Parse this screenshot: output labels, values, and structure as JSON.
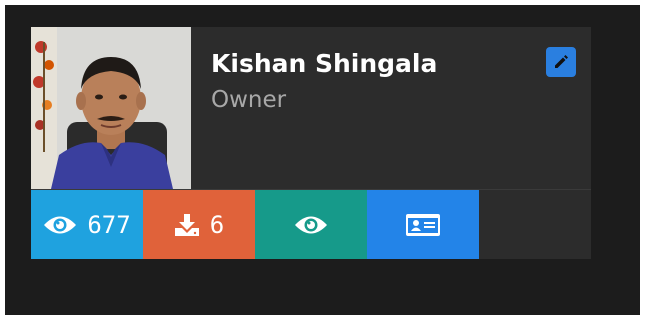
{
  "profile": {
    "name": "Kishan Shingala",
    "role": "Owner",
    "photo_icon": "profile-photo"
  },
  "actions": {
    "views_count": "677",
    "downloads_count": "6"
  },
  "icons": {
    "edit": "pencil-icon",
    "views": "eye-icon",
    "downloads": "download-icon",
    "preview": "eye-icon",
    "contact": "id-card-icon"
  },
  "colors": {
    "edit": "#2a7fe0",
    "views": "#1fa2df",
    "downloads": "#e0623a",
    "preview": "#169a8a",
    "contact": "#2384e8",
    "card_bg": "#2c2c2c"
  }
}
